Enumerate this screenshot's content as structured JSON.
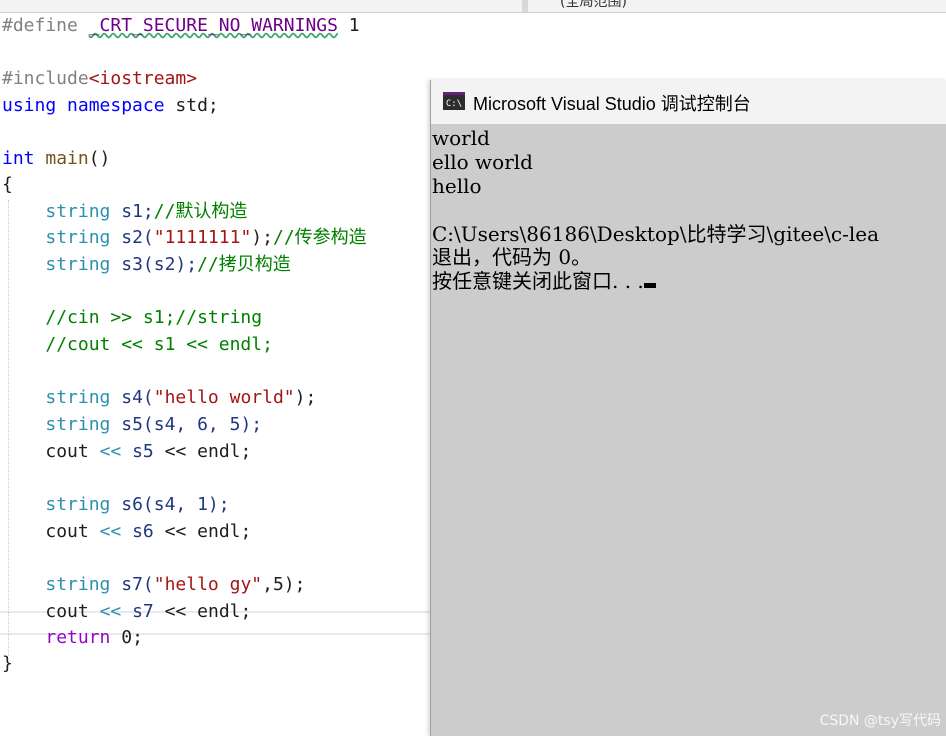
{
  "top_tab_text": "(全局范围)",
  "code": {
    "define_kw": "#define",
    "define_name": "_CRT_SECURE_NO_WARNINGS",
    "define_val": "1",
    "include_kw": "#include",
    "include_file": "<iostream>",
    "using_kw": "using",
    "namespace_kw": "namespace",
    "std": "std;",
    "int_kw": "int",
    "main_name": "main",
    "main_parens": "()",
    "open_brace": "{",
    "close_brace": "}",
    "string_kw": "string",
    "s1_decl": "s1;",
    "s1_comment": "//默认构造",
    "s2_decl": "s2(",
    "s2_str": "\"1111111\"",
    "s2_end": ");",
    "s2_comment": "//传参构造",
    "s3_decl": "s3(s2);",
    "s3_comment": "//拷贝构造",
    "cmt_cin": "//cin >> s1;//string",
    "cmt_cout": "//cout << s1 << endl;",
    "s4_decl": "s4(",
    "s4_str": "\"hello world\"",
    "s4_end": ");",
    "s5_decl": "s5(s4, 6, 5);",
    "cout_kw": "cout",
    "op": "<<",
    "s5": "s5",
    "endl": "endl;",
    "s6_decl": "s6(s4, 1);",
    "s6": "s6",
    "s7_decl": "s7(",
    "s7_str": "\"hello gy\"",
    "s7_end": ",5);",
    "s7": "s7",
    "return_kw": "return",
    "return_val": "0;"
  },
  "console": {
    "title": "Microsoft Visual Studio 调试控制台",
    "icon_text": "C:\\",
    "lines": [
      "world",
      "ello world",
      "hello",
      "",
      "C:\\Users\\86186\\Desktop\\比特学习\\gitee\\c-lea",
      "退出，代码为 0。",
      "按任意键关闭此窗口. . ."
    ]
  },
  "watermark": "CSDN @tsy写代码"
}
